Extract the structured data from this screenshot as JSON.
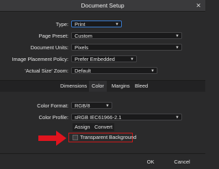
{
  "window": {
    "title": "Document Setup",
    "close_glyph": "✕"
  },
  "fields": {
    "type": {
      "label": "Type:",
      "value": "Print"
    },
    "page_preset": {
      "label": "Page Preset:",
      "value": "Custom"
    },
    "document_units": {
      "label": "Document Units:",
      "value": "Pixels"
    },
    "image_placement": {
      "label": "Image Placement Policy:",
      "value": "Prefer Embedded"
    },
    "actual_size_zoom": {
      "label": "'Actual Size' Zoom:",
      "value": "Default"
    }
  },
  "tabs": [
    "Dimensions",
    "Color",
    "Margins",
    "Bleed"
  ],
  "active_tab": "Color",
  "color": {
    "format": {
      "label": "Color Format:",
      "value": "RGB/8"
    },
    "profile": {
      "label": "Color Profile:",
      "value": "sRGB IEC61966-2.1"
    },
    "assign_label": "Assign",
    "convert_label": "Convert",
    "transparent_background_label": "Transparent Background",
    "transparent_background_checked": false
  },
  "footer": {
    "ok_label": "OK",
    "cancel_label": "Cancel"
  },
  "colors": {
    "accent_red": "#e0141e",
    "focus_blue": "#3b7fd6",
    "bg": "#2a2a2b"
  }
}
